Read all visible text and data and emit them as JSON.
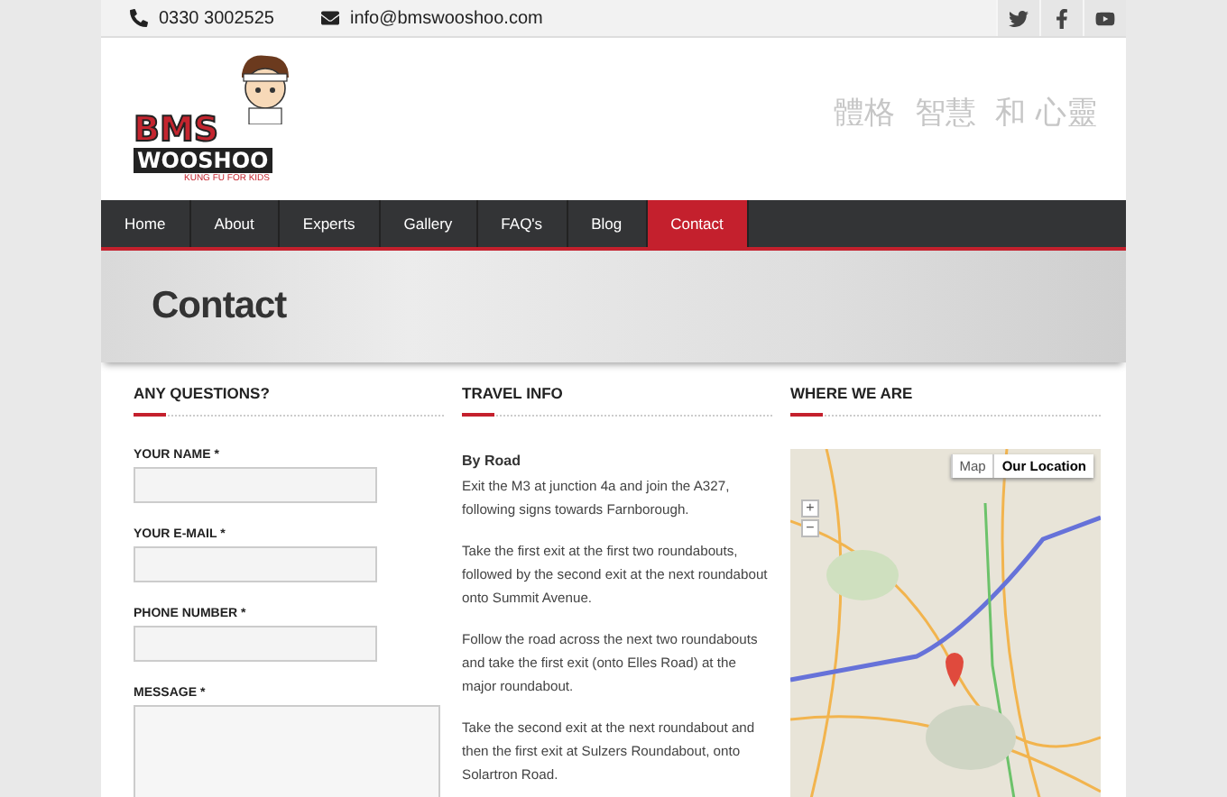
{
  "top_bar": {
    "phone": "0330 3002525",
    "email": "info@bmswooshoo.com",
    "social": [
      {
        "kind": "twitter"
      },
      {
        "kind": "facebook"
      },
      {
        "kind": "youtube"
      }
    ]
  },
  "header": {
    "logo": {
      "line1": "BMS",
      "line2": "WOOSHOO",
      "tagline": "KUNG FU FOR KIDS"
    },
    "motto": "體格  智慧  和 心靈"
  },
  "nav": [
    {
      "label": "Home",
      "selected": false
    },
    {
      "label": "About",
      "selected": false
    },
    {
      "label": "Experts",
      "selected": false
    },
    {
      "label": "Gallery",
      "selected": false
    },
    {
      "label": "FAQ's",
      "selected": false
    },
    {
      "label": "Blog",
      "selected": false
    },
    {
      "label": "Contact",
      "selected": true
    }
  ],
  "banner": {
    "title": "Contact"
  },
  "questions": {
    "heading": "ANY QUESTIONS?",
    "fields": [
      {
        "label": "YOUR NAME *",
        "kind": "input"
      },
      {
        "label": "YOUR E-MAIL *",
        "kind": "input"
      },
      {
        "label": "PHONE NUMBER *",
        "kind": "input"
      },
      {
        "label": "MESSAGE *",
        "kind": "textarea"
      }
    ]
  },
  "travel": {
    "heading": "TRAVEL INFO",
    "subheading": "By Road",
    "paragraphs": [
      "Exit the M3 at junction 4a and join the A327, following signs towards Farnborough.",
      "Take the first exit at the first two roundabouts, followed by the second exit at the next roundabout onto Summit Avenue.",
      "Follow the road across the next two roundabouts and take the first exit (onto Elles Road) at the major roundabout.",
      "Take the second exit at the next roundabout and then the first exit at Sulzers Roundabout, onto Solartron Road."
    ]
  },
  "where": {
    "heading": "WHERE WE ARE",
    "map_types": [
      {
        "label": "Map",
        "selected": false
      },
      {
        "label": "Our Location",
        "selected": true
      }
    ],
    "zoom": [
      "+",
      "−"
    ]
  }
}
